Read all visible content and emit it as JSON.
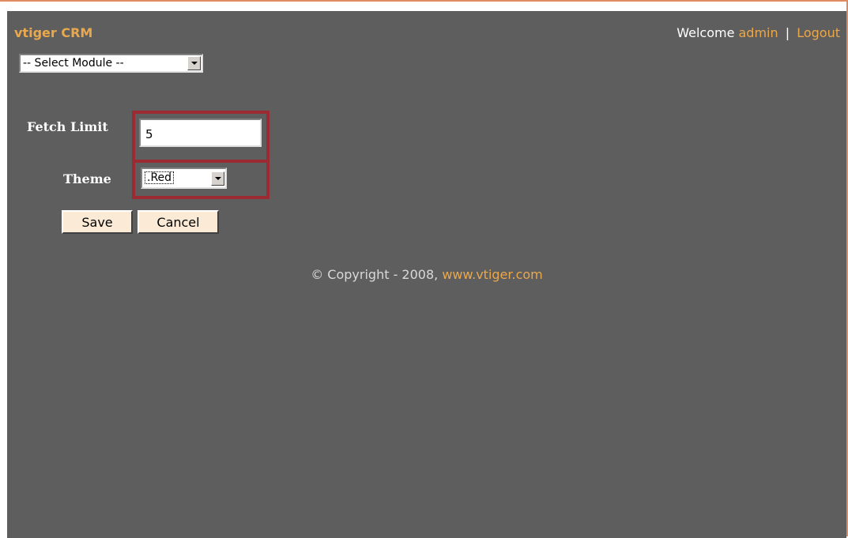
{
  "header": {
    "brand": "vtiger CRM",
    "welcome_text": "Welcome",
    "user_link": "admin",
    "separator": "|",
    "logout_link": "Logout"
  },
  "module_select": {
    "selected": "-- Select Module --"
  },
  "form": {
    "fetch_limit_label": "Fetch Limit",
    "fetch_limit_value": "5",
    "theme_label": "Theme",
    "theme_selected": ".Red"
  },
  "buttons": {
    "save_label": "Save",
    "cancel_label": "Cancel"
  },
  "footer": {
    "copyright_text": "© Copyright - 2008,",
    "site_link": "www.vtiger.com"
  },
  "colors": {
    "background": "#5e5e5e",
    "accent_link": "#e9a84d",
    "highlight_border": "#9b2a33",
    "button_bg": "#fbebd6"
  },
  "icons": {
    "dropdown": "chevron-down-icon"
  }
}
